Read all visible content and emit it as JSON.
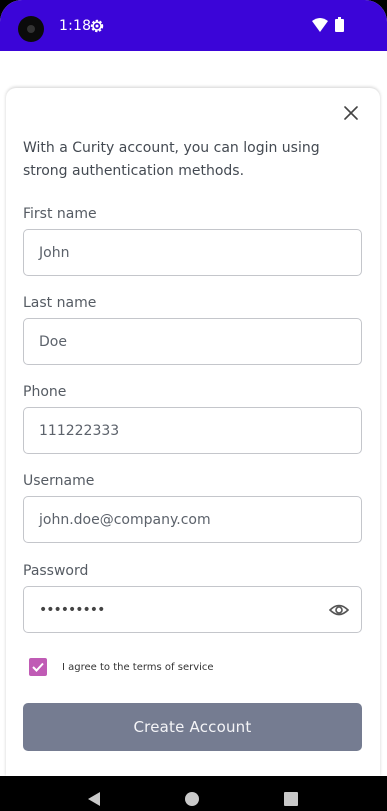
{
  "status_bar": {
    "time": "1:18",
    "color": "#3b05d8",
    "icons": [
      "camera-icon",
      "settings-icon",
      "wifi-icon",
      "battery-icon"
    ]
  },
  "dialog": {
    "close_icon": "close-icon",
    "intro": "With a Curity account, you can login using strong authentication methods."
  },
  "form": {
    "first_name": {
      "label": "First name",
      "value": "John"
    },
    "last_name": {
      "label": "Last name",
      "value": "Doe"
    },
    "phone": {
      "label": "Phone",
      "value": "111222333"
    },
    "username": {
      "label": "Username",
      "value": "john.doe@company.com"
    },
    "password": {
      "label": "Password",
      "value": "•••••••••",
      "toggle_icon": "eye-icon"
    },
    "terms": {
      "checked": true,
      "label": "I agree to the terms of service",
      "color": "#c05bb5"
    },
    "submit_label": "Create Account",
    "submit_color": "#757c91"
  },
  "nav_bar": {
    "icons": [
      "back-icon",
      "home-icon",
      "recents-icon"
    ]
  }
}
